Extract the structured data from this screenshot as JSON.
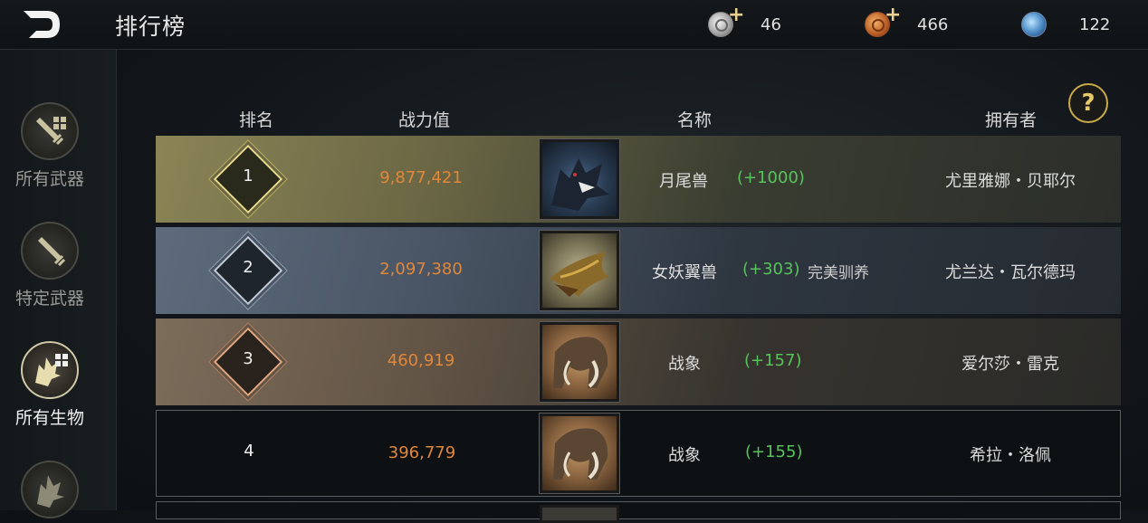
{
  "header": {
    "title": "排行榜"
  },
  "currencies": [
    {
      "icon": "silver-coin-icon",
      "amount": "46"
    },
    {
      "icon": "gold-coin-icon",
      "amount": "466"
    },
    {
      "icon": "gem-icon",
      "amount": "122"
    }
  ],
  "sidebar": {
    "items": [
      {
        "label": "所有武器",
        "icon": "sword-grid-icon",
        "active": false
      },
      {
        "label": "特定武器",
        "icon": "sword-icon",
        "active": false
      },
      {
        "label": "所有生物",
        "icon": "dragon-grid-icon",
        "active": true
      },
      {
        "label": "",
        "icon": "dragon-icon",
        "active": false
      }
    ]
  },
  "help": {
    "label": "?"
  },
  "table": {
    "columns": {
      "rank": "排名",
      "power": "战力值",
      "name": "名称",
      "owner": "拥有者"
    },
    "rows": [
      {
        "rank": "1",
        "power": "9,877,421",
        "name": "月尾兽",
        "bonus": "(+1000)",
        "note": "",
        "owner": "尤里雅娜・贝耶尔",
        "portrait": "wolf-beast-portrait"
      },
      {
        "rank": "2",
        "power": "2,097,380",
        "name": "女妖翼兽",
        "bonus": "(+303)",
        "note": "完美驯养",
        "owner": "尤兰达・瓦尔德玛",
        "portrait": "wyvern-portrait"
      },
      {
        "rank": "3",
        "power": "460,919",
        "name": "战象",
        "bonus": "(+157)",
        "note": "",
        "owner": "爱尔莎・雷克",
        "portrait": "war-elephant-portrait"
      },
      {
        "rank": "4",
        "power": "396,779",
        "name": "战象",
        "bonus": "(+155)",
        "note": "",
        "owner": "希拉・洛佩",
        "portrait": "war-elephant-portrait"
      }
    ]
  },
  "colors": {
    "power": "#e0873a",
    "bonus": "#58c35c",
    "gold_accent": "#e8c968"
  }
}
